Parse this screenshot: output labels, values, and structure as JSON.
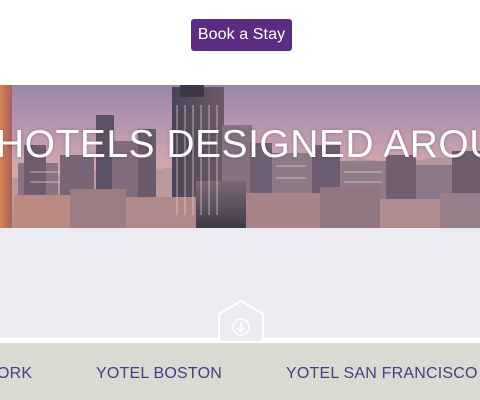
{
  "header": {
    "book_button_label": "Book a Stay"
  },
  "hero": {
    "title": "HOTELS DESIGNED AROU"
  },
  "scroll_icon": "arrow-down-icon",
  "locations": [
    {
      "label": "ORK"
    },
    {
      "label": "YOTEL BOSTON"
    },
    {
      "label": "YOTEL SAN FRANCISCO (C"
    }
  ],
  "colors": {
    "brand_purple": "#5a2d82",
    "nav_text": "#4b3a84",
    "band_background": "#ecebf1",
    "nav_background": "#d9dad2"
  }
}
